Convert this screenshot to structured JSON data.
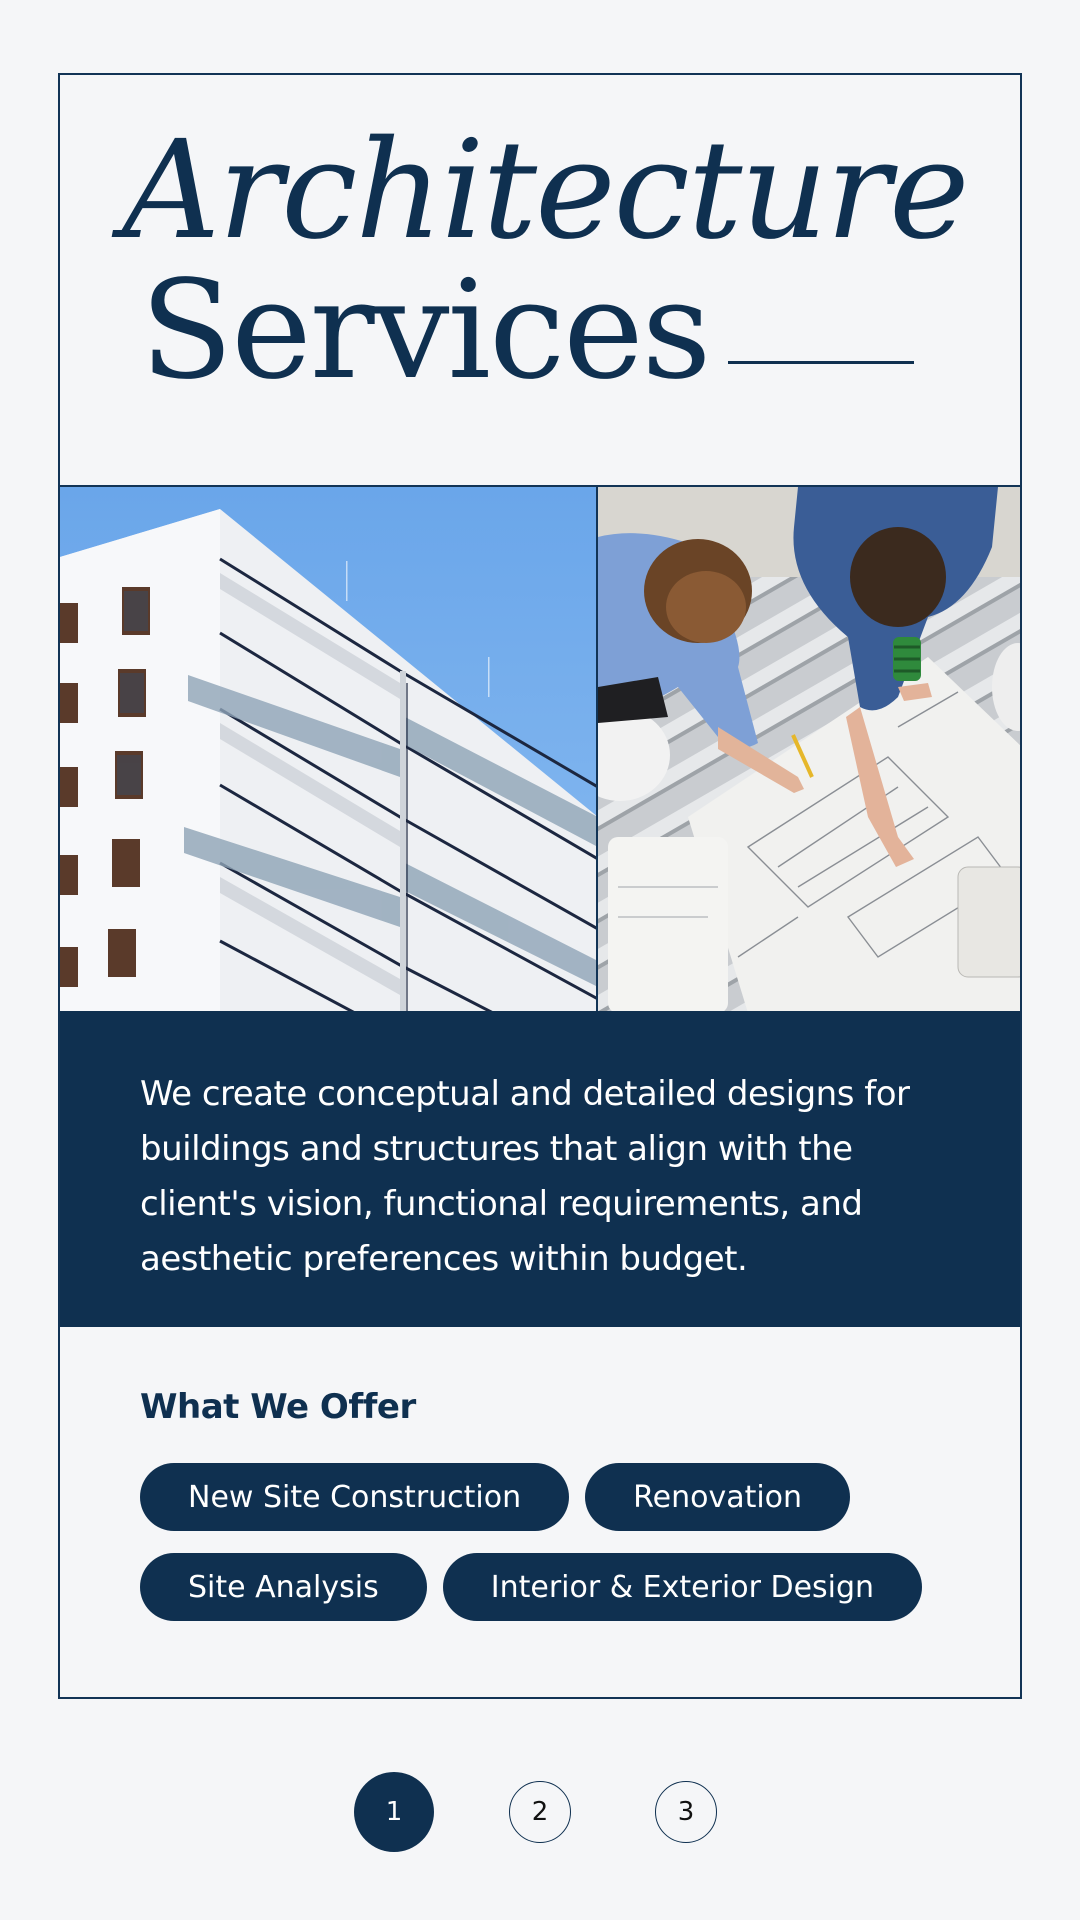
{
  "hero": {
    "title_line1": "Architecture",
    "title_line2": "Services"
  },
  "images": {
    "left": "building-facade-photo",
    "right": "architects-reviewing-blueprints-photo"
  },
  "intro": {
    "text": "We create conceptual and detailed designs for buildings and structures that align with the client's vision, functional requirements, and aesthetic preferences within budget."
  },
  "offer": {
    "title": "What We Offer",
    "chips": [
      "New Site Construction",
      "Renovation",
      "Site Analysis",
      "Interior & Exterior Design"
    ]
  },
  "pagination": {
    "pages": [
      "1",
      "2",
      "3"
    ],
    "current": "1"
  },
  "colors": {
    "primary": "#0f3050",
    "background": "#f5f6f8",
    "on_primary": "#ffffff"
  }
}
